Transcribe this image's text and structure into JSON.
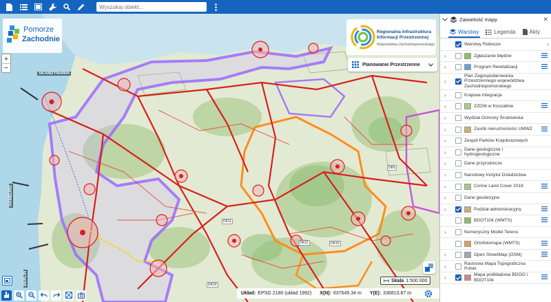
{
  "toolbar": {
    "search_placeholder": "Wyszukaj obiekt...",
    "icons": [
      "file-icon",
      "list-icon",
      "screen-icon",
      "wrench-icon",
      "search-icon",
      "pencil-icon",
      "more-vert-icon"
    ]
  },
  "map": {
    "logo_left": {
      "line1": "Pomorze",
      "line2": "Zachodnie"
    },
    "logo_right": {
      "title": "Regionalna Infrastruktura Informacji Przestrzennej",
      "subtitle": "Województwa Zachodniopomorskiego"
    },
    "plan_button": "Planowanie Przestrzenne",
    "place_labels": [
      "SKANDYNAWIA",
      "HAMBURG",
      "BERLIN"
    ],
    "route_labels": [
      "DK11",
      "DK10",
      "DK20",
      "DK22",
      "DK6"
    ],
    "scale": {
      "label": "Skala",
      "value": "1:500 000"
    },
    "coordinates": {
      "crs_label": "Układ:",
      "crs_value": "EPSG 2180 (układ 1992)",
      "x_label": "X(N):",
      "x_value": "637645.34 m",
      "y_label": "Y(E):",
      "y_value": "336813.87 m"
    },
    "colors": {
      "roads": "#d81e1e",
      "purple_zone": "#9b6bff",
      "orange_zone": "#ff8c1a",
      "toolbar": "#1565c0"
    }
  },
  "panel": {
    "title": "Zawartość mapy",
    "tabs": [
      {
        "label": "Warstwy",
        "active": true
      },
      {
        "label": "Legenda",
        "active": false
      },
      {
        "label": "Akty",
        "active": false
      }
    ],
    "layers": [
      {
        "name": "Warstwy Robocze",
        "checked": true,
        "expandable": false,
        "thumb": false,
        "menu": false
      },
      {
        "name": "Zgłaszanie błędów",
        "checked": false,
        "expandable": true,
        "thumb": true,
        "menu": true
      },
      {
        "name": "Program Rewitalizacji",
        "checked": false,
        "expandable": true,
        "thumb": true,
        "menu": true
      },
      {
        "name": "Plan Zagospodarowania Przestrzennego województwa Zachodniopomorskiego",
        "checked": true,
        "expandable": true,
        "thumb": false,
        "menu": false
      },
      {
        "name": "Krajowa Integracja",
        "checked": false,
        "expandable": true,
        "thumb": false,
        "menu": false
      },
      {
        "name": "ZZDW w Koszalinie",
        "checked": false,
        "expandable": true,
        "thumb": true,
        "menu": true
      },
      {
        "name": "Wydział Ochrony Środowiska",
        "checked": false,
        "expandable": true,
        "thumb": false,
        "menu": false
      },
      {
        "name": "Zasób nieruchomości UMWZ",
        "checked": false,
        "expandable": true,
        "thumb": true,
        "menu": true
      },
      {
        "name": "Zespół Parków Krajobrazowych",
        "checked": false,
        "expandable": true,
        "thumb": false,
        "menu": false
      },
      {
        "name": "Dane geologiczne i hydrogeologiczne",
        "checked": false,
        "expandable": true,
        "thumb": false,
        "menu": false
      },
      {
        "name": "Dane przyrodnicze",
        "checked": false,
        "expandable": true,
        "thumb": false,
        "menu": false
      },
      {
        "name": "Narodowy Instytut Dziedzictwa",
        "checked": false,
        "expandable": true,
        "thumb": false,
        "menu": false
      },
      {
        "name": "Corine Land Cover 2018",
        "checked": false,
        "expandable": true,
        "thumb": true,
        "menu": true
      },
      {
        "name": "Dane geodezyjne",
        "checked": false,
        "expandable": true,
        "thumb": false,
        "menu": false
      },
      {
        "name": "Podział administracyjny",
        "checked": true,
        "expandable": true,
        "thumb": true,
        "menu": true
      },
      {
        "name": "BDOT10k (WMTS)",
        "checked": false,
        "expandable": false,
        "thumb": true,
        "menu": true
      },
      {
        "name": "Numeryczny Model Terenu",
        "checked": false,
        "expandable": true,
        "thumb": false,
        "menu": false
      },
      {
        "name": "Ortofotomapa (WMTS)",
        "checked": false,
        "expandable": false,
        "thumb": true,
        "menu": true
      },
      {
        "name": "Open StreetMap (OSM)",
        "checked": false,
        "expandable": true,
        "thumb": true,
        "menu": true
      },
      {
        "name": "Rastrowa Mapa Topograficzna Polski",
        "checked": false,
        "expandable": true,
        "thumb": false,
        "menu": false
      },
      {
        "name": "Mapa podkładowa BDOO i BDOT10k",
        "checked": true,
        "expandable": true,
        "thumb": true,
        "menu": true
      }
    ]
  }
}
